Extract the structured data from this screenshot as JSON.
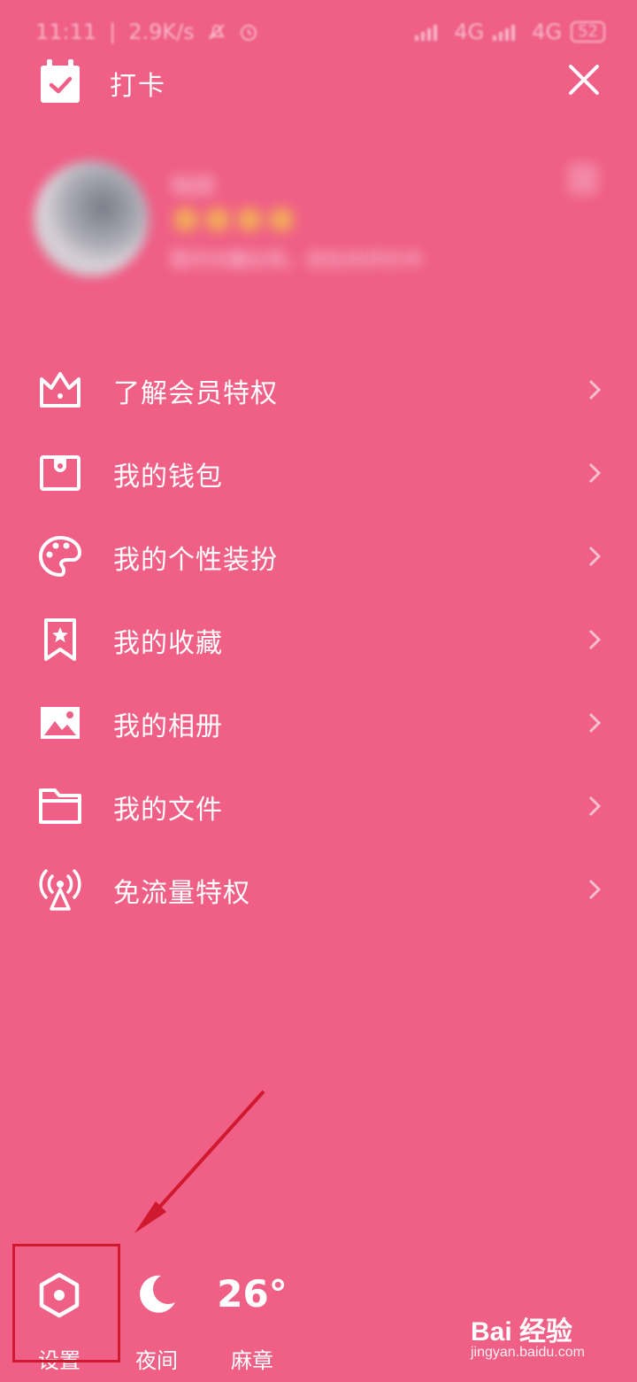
{
  "status_bar": {
    "time": "11:11",
    "speed": "2.9K/s",
    "net1": "4G",
    "net2": "4G",
    "battery": "52"
  },
  "header": {
    "checkin_label": "打卡"
  },
  "profile": {
    "username": "匈奴",
    "subtitle": "暂时对魔女和，但在向评价中",
    "star_count": 4
  },
  "menu": {
    "items": [
      {
        "label": "了解会员特权"
      },
      {
        "label": "我的钱包"
      },
      {
        "label": "我的个性装扮"
      },
      {
        "label": "我的收藏"
      },
      {
        "label": "我的相册"
      },
      {
        "label": "我的文件"
      },
      {
        "label": "免流量特权"
      }
    ]
  },
  "bottom_bar": {
    "settings_label": "设置",
    "night_label": "夜间",
    "weather_temp": "26°",
    "weather_city": "麻章"
  },
  "watermark": {
    "main": "Bai 经验",
    "sub": "jingyan.baidu.com"
  },
  "colors": {
    "background": "#EF5F86",
    "annotation": "#D0182F"
  }
}
